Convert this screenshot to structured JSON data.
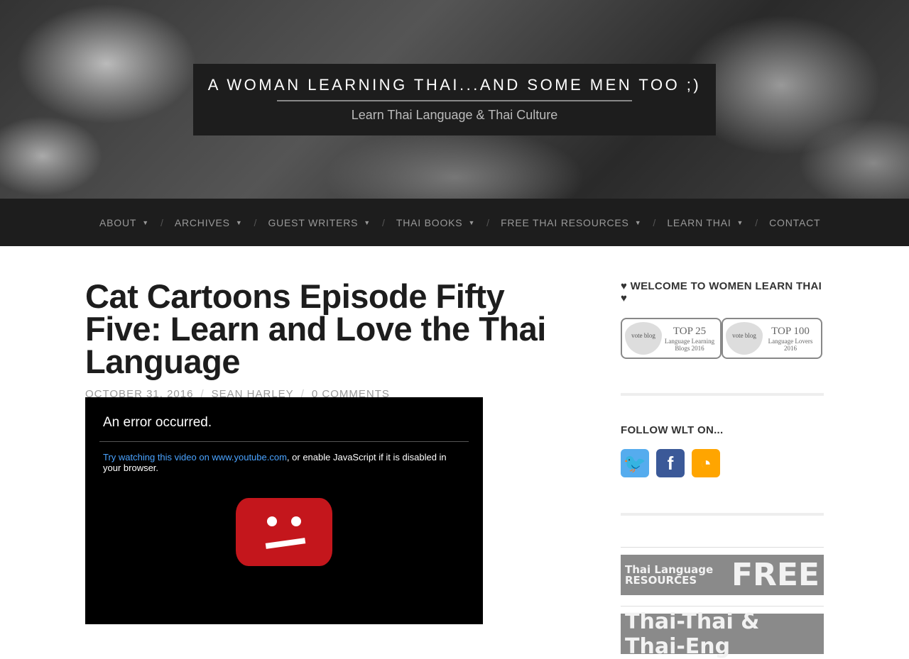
{
  "header": {
    "title": "A WOMAN LEARNING THAI...AND SOME MEN TOO ;)",
    "tagline": "Learn Thai Language & Thai Culture"
  },
  "nav": {
    "items": [
      {
        "label": "ABOUT",
        "dropdown": true
      },
      {
        "label": "ARCHIVES",
        "dropdown": true
      },
      {
        "label": "GUEST WRITERS",
        "dropdown": true
      },
      {
        "label": "THAI BOOKS",
        "dropdown": true
      },
      {
        "label": "FREE THAI RESOURCES",
        "dropdown": true
      },
      {
        "label": "LEARN THAI",
        "dropdown": true
      },
      {
        "label": "CONTACT",
        "dropdown": false
      }
    ],
    "separator": "/",
    "caret": "▼"
  },
  "post": {
    "title": "Cat Cartoons Episode Fifty Five: Learn and Love the Thai Language",
    "date": "OCTOBER 31, 2016",
    "author": "SEAN HARLEY",
    "comments": "0 COMMENTS",
    "sep": "/"
  },
  "video": {
    "error": "An error occurred.",
    "link": "Try watching this video on www.youtube.com",
    "rest": ", or enable JavaScript if it is disabled in your browser."
  },
  "sidebar": {
    "welcome": "♥ WELCOME TO WOMEN LEARN THAI ♥",
    "badges": [
      {
        "heading": "TOP 25",
        "sub1": "Language Learning",
        "sub2": "Blogs 2016",
        "heart": "vote blog"
      },
      {
        "heading": "TOP 100",
        "sub1": "Language Lovers",
        "sub2": "2016",
        "heart": "vote blog"
      }
    ],
    "follow": "FOLLOW WLT ON...",
    "socials": [
      {
        "name": "twitter",
        "color": "#55acee",
        "glyph": "🐦"
      },
      {
        "name": "facebook",
        "color": "#3b5998",
        "glyph": "f"
      },
      {
        "name": "rss",
        "color": "#ffa500",
        "glyph": "◔"
      }
    ],
    "banner1": {
      "line1": "Thai Language",
      "line2": "RESOURCES",
      "big": "FREE"
    },
    "banner2": {
      "text": "Thai-Thai & Thai-Eng"
    }
  }
}
